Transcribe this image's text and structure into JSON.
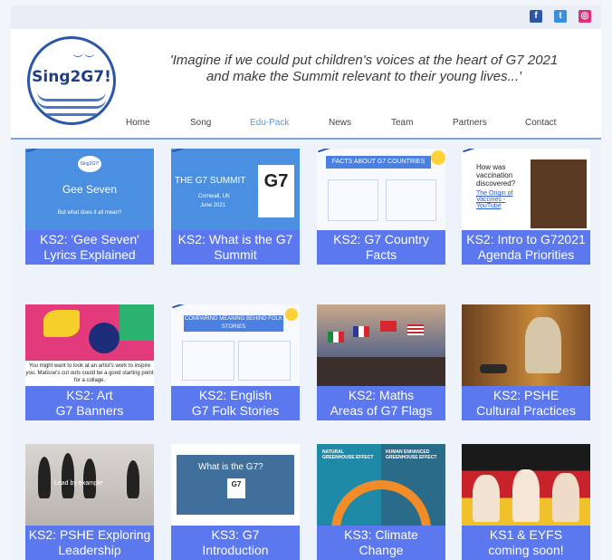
{
  "social": {
    "facebook_icon": "facebook-icon",
    "twitter_icon": "twitter-icon",
    "instagram_icon": "instagram-icon"
  },
  "logo": {
    "text": "Sing2G7!"
  },
  "tagline": {
    "line1": "'Imagine if we could put children's voices at the heart of G7 2021",
    "line2": "and make the Summit relevant to their young lives...'"
  },
  "nav": {
    "items": [
      {
        "label": "Home"
      },
      {
        "label": "Song"
      },
      {
        "label": "Edu-Pack"
      },
      {
        "label": "News"
      },
      {
        "label": "Team"
      },
      {
        "label": "Partners"
      },
      {
        "label": "Contact"
      }
    ],
    "active": "Edu-Pack"
  },
  "colors": {
    "label_bg": "#5b78ef",
    "nav_active": "#5c9cd8",
    "divider": "#7ea3d8",
    "logo_blue": "#2c56a8"
  },
  "cards": [
    {
      "line1": "KS2: 'Gee Seven'",
      "line2": "Lyrics Explained",
      "thumb": {
        "title": "Gee Seven",
        "subtitle": "But what does it all mean?",
        "logo": "Sing2G7!"
      }
    },
    {
      "line1": "KS2: What is the G7",
      "line2": "Summit",
      "thumb": {
        "title": "THE G7 SUMMIT",
        "place": "Cornwall, UK",
        "date": "June 2021",
        "badge": "G7"
      }
    },
    {
      "line1": "KS2: G7 Country",
      "line2": "Facts",
      "thumb": {
        "title": "FACTS ABOUT G7 COUNTRIES"
      }
    },
    {
      "line1": "KS2: Intro to G72021",
      "line2": "Agenda Priorities",
      "thumb": {
        "question": "How was vaccination discovered?",
        "link": "The Origin of Vaccines - YouTube"
      }
    },
    {
      "line1": "KS2: Art",
      "line2": "G7 Banners",
      "thumb": {
        "caption": "You might want to look at an artist's work to inspire you. Matisse's cut outs could be a good starting point for a collage."
      }
    },
    {
      "line1": "KS2: English",
      "line2": "G7 Folk Stories",
      "thumb": {
        "title": "COMPARING MEANING BEHIND FOLK STORIES"
      }
    },
    {
      "line1": "KS2: Maths",
      "line2": "Areas of G7 Flags",
      "thumb": {}
    },
    {
      "line1": "KS2: PSHE",
      "line2": "Cultural Practices",
      "thumb": {}
    },
    {
      "line1": "KS2: PSHE  Exploring",
      "line2": "Leadership",
      "thumb": {
        "caption": "Lead by example"
      }
    },
    {
      "line1": "KS3: G7",
      "line2": "Introduction",
      "thumb": {
        "title": "What is the G7?",
        "badge": "G7"
      }
    },
    {
      "line1": "KS3: Climate",
      "line2": "Change",
      "thumb": {
        "left": "NATURAL GREENHOUSE EFFECT",
        "right": "HUMAN ENHANCED GREENHOUSE EFFECT"
      }
    },
    {
      "line1": "KS1 & EYFS",
      "line2": "coming soon!",
      "thumb": {}
    }
  ]
}
